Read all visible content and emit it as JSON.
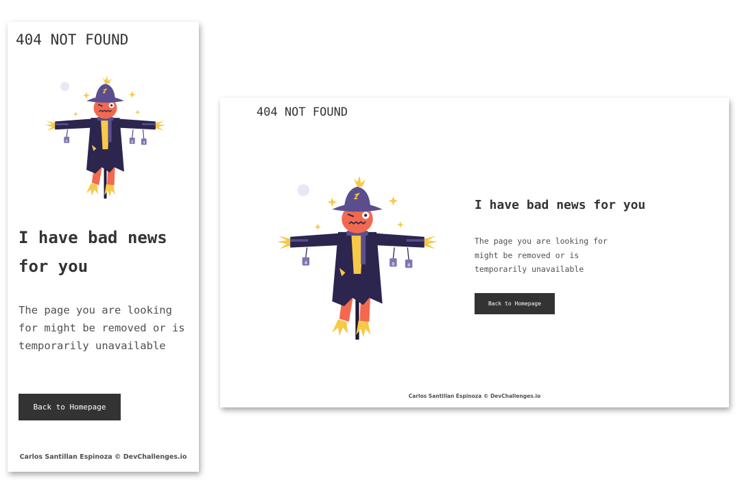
{
  "mobile": {
    "logo": "404 NOT FOUND",
    "heading": "I have bad news for you",
    "message": "The page you are looking for might be removed or is temporarily unavailable",
    "button_label": "Back to Homepage",
    "footer": "Carlos Santillan Espinoza © DevChallenges.io"
  },
  "desktop": {
    "logo": "404 NOT FOUND",
    "heading": "I have bad news for you",
    "message": "The page you are looking for might be removed or is temporarily unavailable",
    "button_label": "Back to Homepage",
    "footer": "Carlos Santillan Espinoza © DevChallenges.io"
  },
  "illustration": {
    "name": "scarecrow-illustration",
    "sign_labels": [
      "4",
      "0",
      "4"
    ]
  },
  "colors": {
    "text_dark": "#333333",
    "text_body": "#4F4F4F",
    "button_bg": "#333333",
    "button_text": "#FFFFFF",
    "hat": "#5A4E8E",
    "coat": "#2C254E",
    "face": "#F2694F",
    "straw": "#F7C948",
    "pole": "#1E1A38",
    "circle": "#E8EAF6"
  }
}
